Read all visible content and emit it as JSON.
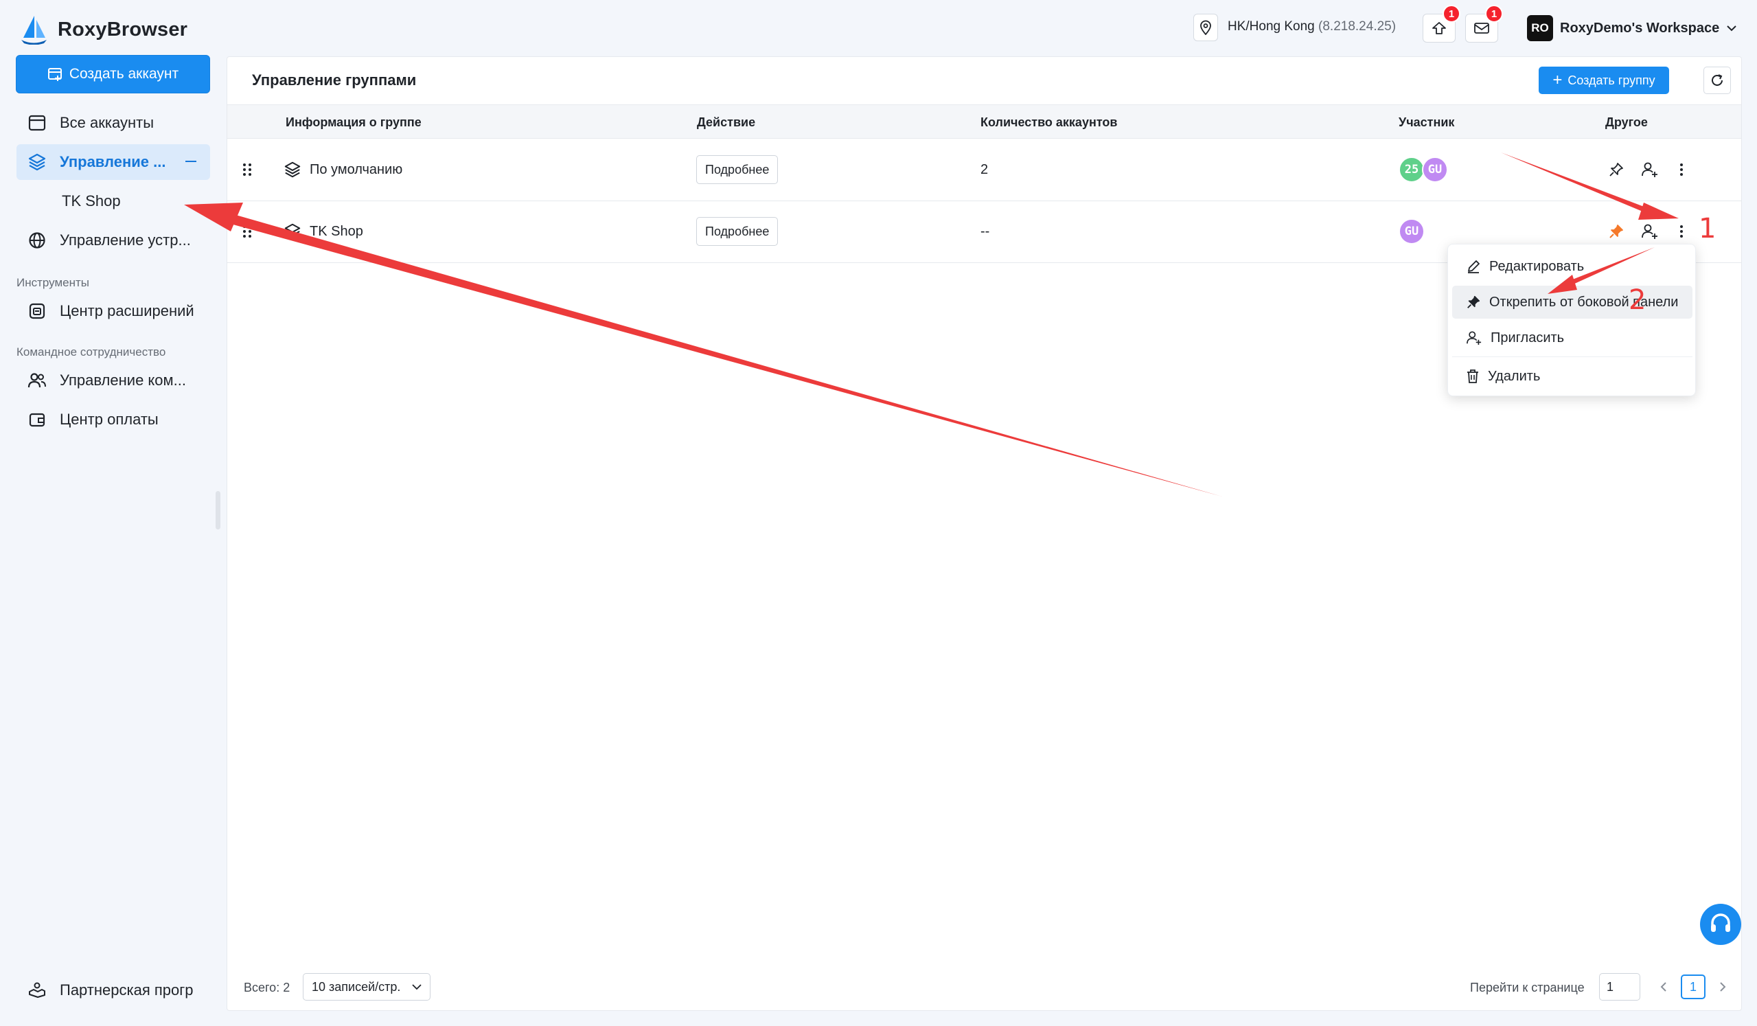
{
  "app": {
    "name": "RoxyBrowser"
  },
  "sidebar": {
    "create_label": "Создать аккаунт",
    "items": [
      {
        "label": "Все аккаунты"
      },
      {
        "label": "Управление ..."
      },
      {
        "label": "TK Shop"
      },
      {
        "label": "Управление устр..."
      }
    ],
    "section_tools": "Инструменты",
    "tools_items": [
      {
        "label": "Центр расширений"
      }
    ],
    "section_team": "Командное сотрудничество",
    "team_items": [
      {
        "label": "Управление ком..."
      },
      {
        "label": "Центр оплаты"
      }
    ],
    "partner_label": "Партнерская прогр"
  },
  "topbar": {
    "location": "HK/Hong Kong",
    "ip": "(8.218.24.25)",
    "update_badge": "1",
    "mail_badge": "1",
    "workspace_avatar": "RO",
    "workspace_name": "RoxyDemo's Workspace"
  },
  "panel": {
    "title": "Управление группами",
    "create_group": "Создать группу",
    "columns": [
      "Информация о группе",
      "Действие",
      "Количество аккаунтов",
      "Участник",
      "Другое"
    ],
    "rows": [
      {
        "name": "По умолчанию",
        "detail": "Подробнее",
        "count": "2",
        "members": [
          "25",
          "GU"
        ]
      },
      {
        "name": "TK Shop",
        "detail": "Подробнее",
        "count": "--",
        "members": [
          "GU"
        ]
      }
    ]
  },
  "menu": {
    "items": [
      {
        "label": "Редактировать"
      },
      {
        "label": "Открепить от боковой панели"
      },
      {
        "label": "Пригласить"
      },
      {
        "label": "Удалить"
      }
    ]
  },
  "footer": {
    "total": "Всего: 2",
    "page_size": "10 записей/стр.",
    "goto_label": "Перейти к странице",
    "goto_value": "1",
    "current_page": "1"
  },
  "annotations": {
    "step1": "1",
    "step2": "2"
  },
  "colors": {
    "accent": "#1a8cf0",
    "annotation": "#ec3b3b",
    "pin_active": "#f5792a",
    "member_green": "#5fd08a",
    "member_purple": "#c08af2"
  }
}
